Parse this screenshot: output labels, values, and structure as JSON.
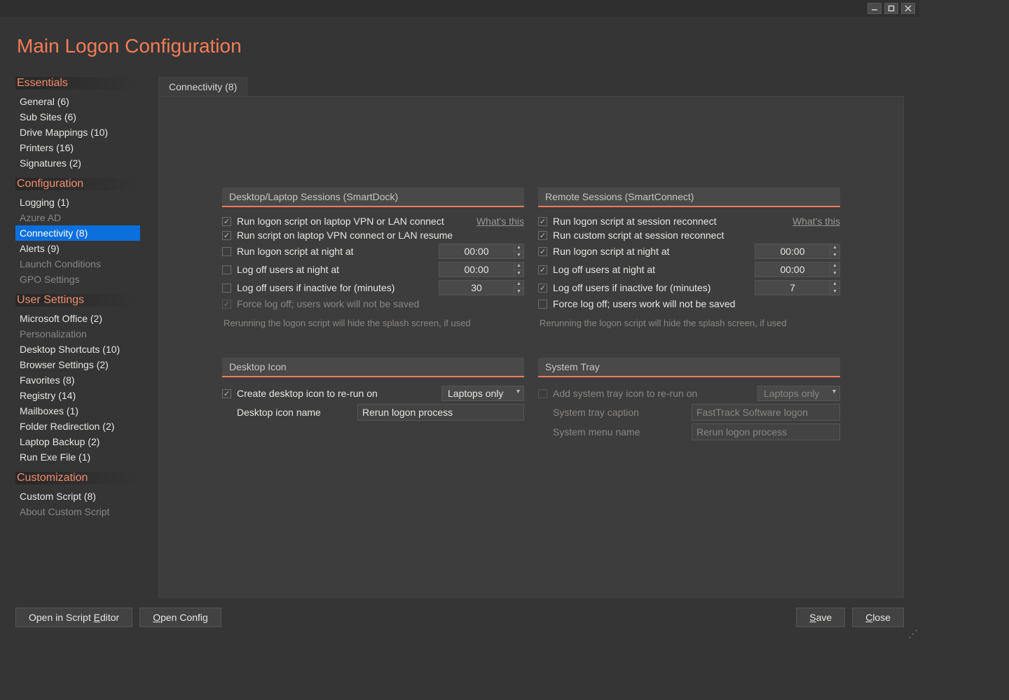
{
  "title": "Main Logon Configuration",
  "sidebar": [
    {
      "heading": "Essentials",
      "items": [
        {
          "label": "General (6)"
        },
        {
          "label": "Sub Sites (6)"
        },
        {
          "label": "Drive Mappings (10)"
        },
        {
          "label": "Printers (16)"
        },
        {
          "label": "Signatures (2)"
        }
      ]
    },
    {
      "heading": "Configuration",
      "items": [
        {
          "label": "Logging (1)"
        },
        {
          "label": "Azure AD",
          "dim": true
        },
        {
          "label": "Connectivity (8)",
          "selected": true
        },
        {
          "label": "Alerts (9)"
        },
        {
          "label": "Launch Conditions",
          "dim": true
        },
        {
          "label": "GPO Settings",
          "dim": true
        }
      ]
    },
    {
      "heading": "User Settings",
      "items": [
        {
          "label": "Microsoft Office (2)"
        },
        {
          "label": "Personalization",
          "dim": true
        },
        {
          "label": "Desktop Shortcuts (10)"
        },
        {
          "label": "Browser Settings (2)"
        },
        {
          "label": "Favorites (8)"
        },
        {
          "label": "Registry (14)"
        },
        {
          "label": "Mailboxes (1)"
        },
        {
          "label": "Folder Redirection (2)"
        },
        {
          "label": "Laptop Backup (2)"
        },
        {
          "label": "Run Exe File (1)"
        }
      ]
    },
    {
      "heading": "Customization",
      "items": [
        {
          "label": "Custom Script (8)"
        },
        {
          "label": "About Custom Script",
          "dim": true
        }
      ]
    }
  ],
  "tab_label": "Connectivity (8)",
  "panels": {
    "smartdock": {
      "title": "Desktop/Laptop Sessions (SmartDock)",
      "hint": "What's this",
      "row1": "Run logon script on laptop VPN or LAN connect",
      "row2": "Run script on laptop VPN connect or LAN resume",
      "row3": "Run logon script at night at",
      "row4": "Log off users at night at",
      "row5": "Log off users if inactive for (minutes)",
      "row6": "Force log off; users work will not be saved",
      "val3": "00:00",
      "val4": "00:00",
      "val5": "30",
      "note": "Rerunning the logon script will hide the splash screen, if used"
    },
    "smartconnect": {
      "title": "Remote Sessions (SmartConnect)",
      "hint": "What's this",
      "row1": "Run logon script at session reconnect",
      "row2": "Run custom script at session reconnect",
      "row3": "Run logon script at night at",
      "row4": "Log off users at night at",
      "row5": "Log off users if inactive for (minutes)",
      "row6": "Force log off; users work will not be saved",
      "val3": "00:00",
      "val4": "00:00",
      "val5": "7",
      "note": "Rerunning the logon script will hide the splash screen, if used"
    },
    "deskicon": {
      "title": "Desktop Icon",
      "row1": "Create desktop icon to re-run on",
      "sel1": "Laptops only",
      "row2": "Desktop icon name",
      "val2": "Rerun logon process"
    },
    "systray": {
      "title": "System Tray",
      "row1": "Add system tray icon to re-run on",
      "sel1": "Laptops only",
      "row2": "System tray caption",
      "val2": "FastTrack Software logon",
      "row3": "System menu name",
      "val3": "Rerun logon process"
    }
  },
  "footer": {
    "open_editor": "Open in Script Editor",
    "open_config": "Open Config",
    "save": "Save",
    "close": "Close"
  }
}
